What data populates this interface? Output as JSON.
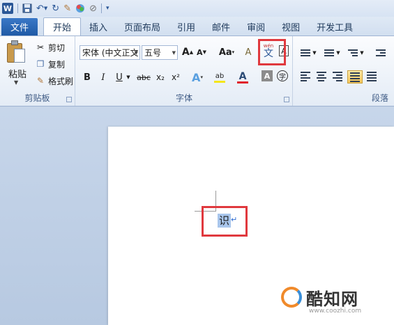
{
  "quick_access": {
    "icons": [
      "word-logo",
      "save-icon",
      "undo-icon",
      "redo-icon",
      "format-painter-icon",
      "color-icon",
      "clear-format-icon",
      "customize-icon"
    ]
  },
  "tabs": {
    "file": "文件",
    "home": "开始",
    "insert": "插入",
    "page_layout": "页面布局",
    "references": "引用",
    "mailings": "邮件",
    "review": "审阅",
    "view": "视图",
    "developer": "开发工具"
  },
  "clipboard": {
    "paste": "粘贴",
    "cut": "剪切",
    "copy": "复制",
    "format_painter": "格式刷",
    "label": "剪贴板"
  },
  "font": {
    "font_name": "宋体 (中文正文",
    "font_size": "五号",
    "grow_symbol": "A",
    "shrink_symbol": "A",
    "change_case": "Aa",
    "clear_format_symbol": "A",
    "phonetic_top": "wén",
    "phonetic_char": "文",
    "char_border_symbol": "A",
    "bold": "B",
    "italic": "I",
    "underline": "U",
    "strikethrough": "abc",
    "subscript": "x₂",
    "superscript": "x²",
    "text_effects": "A",
    "highlight": "ab",
    "font_color": "A",
    "char_shading": "A",
    "enclose_char": "字",
    "label": "字体",
    "font_color_hex": "#e0202a",
    "highlight_hex": "#f5e61a"
  },
  "paragraph": {
    "label": "段落"
  },
  "document": {
    "selected_text": "识",
    "paragraph_mark": "↵"
  },
  "watermark": {
    "title": "酷知网",
    "url": "www.coozhi.com"
  },
  "highlight_color": "#e0393e"
}
